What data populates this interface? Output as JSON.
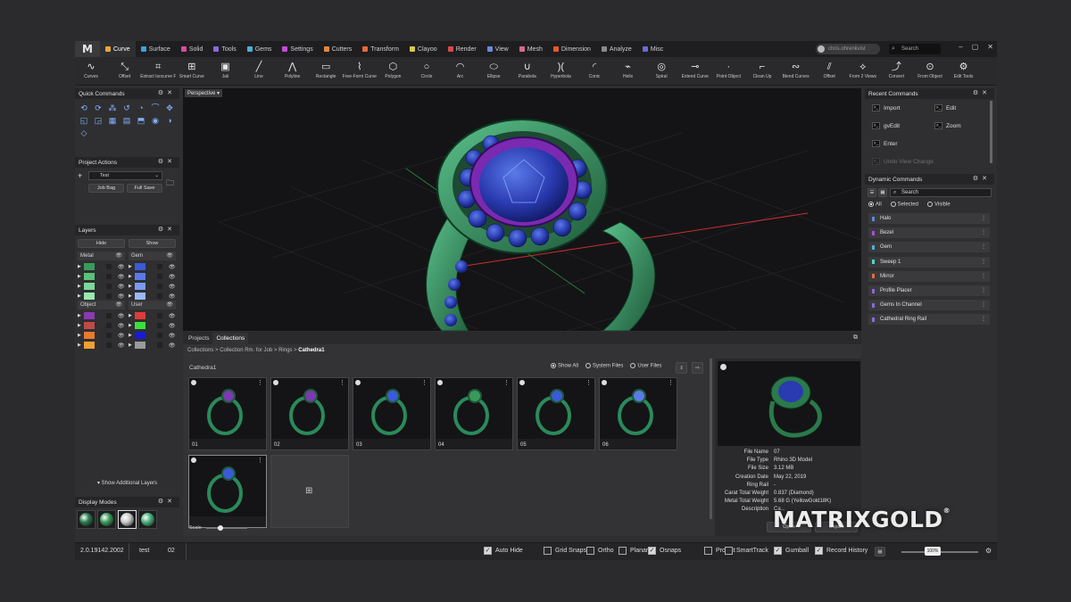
{
  "app": {
    "logo": "M",
    "tabs": [
      {
        "label": "Curve",
        "color": "#e8a53a",
        "active": true
      },
      {
        "label": "Surface",
        "color": "#3fa0d8"
      },
      {
        "label": "Solid",
        "color": "#d84aa0"
      },
      {
        "label": "Tools",
        "color": "#8a6ad8"
      },
      {
        "label": "Gems",
        "color": "#4ab0d8"
      },
      {
        "label": "Settings",
        "color": "#c84ad8"
      },
      {
        "label": "Cutters",
        "color": "#e8863a"
      },
      {
        "label": "Transform",
        "color": "#e86a3a"
      },
      {
        "label": "Clayoo",
        "color": "#d8c84a"
      },
      {
        "label": "Render",
        "color": "#d84a4a"
      },
      {
        "label": "View",
        "color": "#6a8ad8"
      },
      {
        "label": "Mesh",
        "color": "#d86a8a"
      },
      {
        "label": "Dimension",
        "color": "#e85a2a"
      },
      {
        "label": "Analyze",
        "color": "#8a8a8a"
      },
      {
        "label": "Misc",
        "color": "#6a6ad8"
      }
    ],
    "user_name": "chris.ohrenkvist",
    "search_placeholder": "Search",
    "window_controls": [
      "–",
      "▢",
      "✕"
    ]
  },
  "toolbar": [
    {
      "label": "Curves",
      "icon": "∿"
    },
    {
      "label": "Offset",
      "icon": "⤡"
    },
    {
      "label": "Extract Isocurve Fr...",
      "icon": "⌗"
    },
    {
      "label": "Smart Curve",
      "icon": "⊞"
    },
    {
      "label": "Jali",
      "icon": "▣"
    },
    {
      "label": "Line",
      "icon": "╱"
    },
    {
      "label": "Polyline",
      "icon": "⋀"
    },
    {
      "label": "Rectangle",
      "icon": "▭"
    },
    {
      "label": "Free-Form Curve",
      "icon": "⌇"
    },
    {
      "label": "Polygon",
      "icon": "⬡"
    },
    {
      "label": "Circle",
      "icon": "○"
    },
    {
      "label": "Arc",
      "icon": "◠"
    },
    {
      "label": "Ellipse",
      "icon": "⬭"
    },
    {
      "label": "Parabola",
      "icon": "∪"
    },
    {
      "label": "Hyperbola",
      "icon": ")("
    },
    {
      "label": "Conic",
      "icon": "◜"
    },
    {
      "label": "Helix",
      "icon": "⌁"
    },
    {
      "label": "Spiral",
      "icon": "◎"
    },
    {
      "label": "Extend Curve",
      "icon": "⊸"
    },
    {
      "label": "Point Object",
      "icon": "·"
    },
    {
      "label": "Clean Up",
      "icon": "⌐"
    },
    {
      "label": "Blend Curves",
      "icon": "∾"
    },
    {
      "label": "Offset",
      "icon": "⫽"
    },
    {
      "label": "From 2 Views",
      "icon": "⟡"
    },
    {
      "label": "Convert",
      "icon": "⤴"
    },
    {
      "label": "From Object",
      "icon": "⊙"
    },
    {
      "label": "Edit Tools",
      "icon": "⚙"
    }
  ],
  "quick_commands": {
    "title": "Quick Commands",
    "icons": [
      "⟲",
      "⟳",
      "⁂",
      "↺",
      "◔",
      "⌒",
      "✥",
      "◱",
      "◲",
      "▦",
      "▤",
      "⬒",
      "◉",
      "◑",
      "◇"
    ]
  },
  "project_actions": {
    "title": "Project Actions",
    "project": "Test",
    "job_bag": "Job Bag",
    "full_save": "Full Save"
  },
  "layers": {
    "title": "Layers",
    "hide": "Hide",
    "show": "Show",
    "groups": [
      {
        "name": "Metal",
        "colors": [
          "#3a9a5a",
          "#5ac07a",
          "#7ad89a",
          "#9ae8b0"
        ]
      },
      {
        "name": "Gem",
        "colors": [
          "#3a5ad8",
          "#5a7ae8",
          "#7a9af0",
          "#9ab8f8"
        ]
      },
      {
        "name": "Object",
        "colors": [
          "#8a3ab0",
          "#c04a4a",
          "#e87a2a",
          "#f0a030"
        ]
      },
      {
        "name": "User",
        "colors": [
          "#e03a3a",
          "#3ae03a",
          "#1a1ad8",
          "#9a9a9a"
        ]
      }
    ],
    "show_additional": "Show Additional Layers"
  },
  "display_modes": {
    "title": "Display Modes",
    "modes": [
      "#2a7a4a",
      "#3a9a5a",
      "#c8c8c8",
      "#4ab07a"
    ]
  },
  "viewport": {
    "label": "Perspective"
  },
  "collections": {
    "tabs": [
      "Projects",
      "Collections"
    ],
    "breadcrumb": [
      "Collections",
      "Collection Rm. for Job",
      "Rings",
      "Cathedra1"
    ],
    "folder": "Cathedra1",
    "filters": [
      "Show All",
      "System Files",
      "User Files"
    ],
    "items": [
      "01",
      "02",
      "03",
      "04",
      "05",
      "06",
      ""
    ],
    "scale_label": "Scale",
    "scale_value": 0.35
  },
  "file_info": {
    "rows": [
      {
        "key": "File Name",
        "value": "07"
      },
      {
        "key": "File Type",
        "value": "Rhino 3D Model"
      },
      {
        "key": "File Size",
        "value": "3.12 MB"
      },
      {
        "key": "Creation Date",
        "value": "May 22, 2019"
      },
      {
        "key": "Ring Rail",
        "value": "-"
      },
      {
        "key": "Carat Total Weight",
        "value": "0.837 (Diamond)"
      },
      {
        "key": "Metal Total Weight",
        "value": "5.68 G (YellowGold18K)"
      },
      {
        "key": "Description",
        "value": "Ca..."
      }
    ],
    "open_button": "Open",
    "import_button": "Import"
  },
  "recent_commands": {
    "title": "Recent Commands",
    "items": [
      "Import",
      "Edit",
      "gvEdit",
      "Zoom",
      "Enter",
      "Undo View Change"
    ]
  },
  "dynamic_commands": {
    "title": "Dynamic Commands",
    "search_placeholder": "Search",
    "filters": [
      "All",
      "Selected",
      "Visible"
    ],
    "items": [
      {
        "label": "Halo",
        "color": "#5a8ad8"
      },
      {
        "label": "Bezel",
        "color": "#b04ad8"
      },
      {
        "label": "Gem",
        "color": "#4ab0d8"
      },
      {
        "label": "Sweep 1",
        "color": "#4ad8c8"
      },
      {
        "label": "Mirror",
        "color": "#e86a3a"
      },
      {
        "label": "Profile Placer",
        "color": "#8a6ad8"
      },
      {
        "label": "Gems In Channel",
        "color": "#8a6ad8"
      },
      {
        "label": "Cathedral Ring Rail",
        "color": "#8a6ad8"
      }
    ]
  },
  "status": {
    "version": "2.0.19142.2002",
    "project": "test",
    "count": "02",
    "toggles": [
      {
        "label": "Auto Hide",
        "on": true
      },
      {
        "label": "Grid Snaps",
        "on": false
      },
      {
        "label": "Ortho",
        "on": false
      },
      {
        "label": "Planar",
        "on": false
      },
      {
        "label": "Osnaps",
        "on": true
      },
      {
        "label": "Project",
        "on": false
      },
      {
        "label": "SmartTrack",
        "on": false
      },
      {
        "label": "Gumball",
        "on": true
      },
      {
        "label": "Record History",
        "on": true
      }
    ],
    "zoom": "100%"
  },
  "brand": {
    "name": "MATRIXGOLD",
    "mark": "®"
  }
}
